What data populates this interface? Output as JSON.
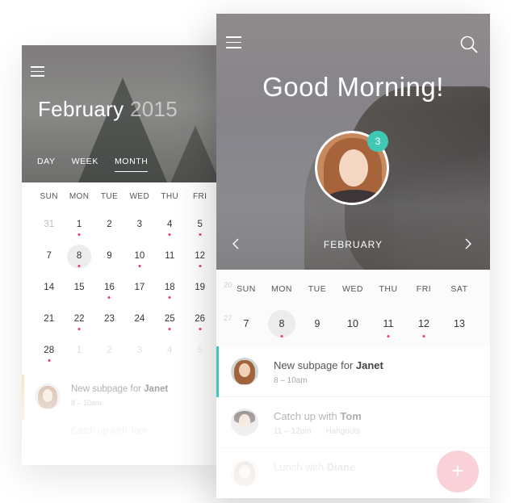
{
  "left_screen": {
    "header": {
      "month": "February",
      "year": "2015",
      "tabs": [
        "DAY",
        "WEEK",
        "MONTH"
      ],
      "active_tab": "MONTH"
    },
    "calendar": {
      "weekdays": [
        "SUN",
        "MON",
        "TUE",
        "WED",
        "THU",
        "FRI"
      ],
      "rows": [
        [
          "31",
          "1",
          "2",
          "3",
          "4",
          "5"
        ],
        [
          "7",
          "8",
          "9",
          "10",
          "11",
          "12"
        ],
        [
          "14",
          "15",
          "16",
          "17",
          "18",
          "19"
        ],
        [
          "21",
          "22",
          "23",
          "24",
          "25",
          "26"
        ],
        [
          "28",
          "1",
          "2",
          "3",
          "4",
          "5"
        ]
      ],
      "selected_day": "8"
    },
    "event": {
      "title_prefix": "New subpage for",
      "title_name": "Janet",
      "time": "8 – 10am"
    },
    "ghost_event": "Catch up with Tom"
  },
  "right_screen": {
    "greeting": "Good Morning!",
    "notification_count": "3",
    "month": "FEBRUARY",
    "week": {
      "weekdays": [
        "SUN",
        "MON",
        "TUE",
        "WED",
        "THU",
        "FRI",
        "SAT"
      ],
      "days": [
        "7",
        "8",
        "9",
        "10",
        "11",
        "12",
        "13"
      ],
      "selected_day": "8",
      "prev_week_days": [
        "20",
        "27"
      ]
    },
    "events": [
      {
        "title_prefix": "New subpage for",
        "title_name": "Janet",
        "time": "8 – 10am",
        "place": ""
      },
      {
        "title_prefix": "Catch up with",
        "title_name": "Tom",
        "time": "11 – 12pm",
        "place": "Hangouts"
      },
      {
        "title_prefix": "Lunch with",
        "title_name": "Diane",
        "time": "",
        "place": ""
      }
    ],
    "fab_label": "+"
  },
  "colors": {
    "accent_teal": "#3fc8b6",
    "event_dot": "#e8385a",
    "fab_pink": "#f05b7a"
  }
}
